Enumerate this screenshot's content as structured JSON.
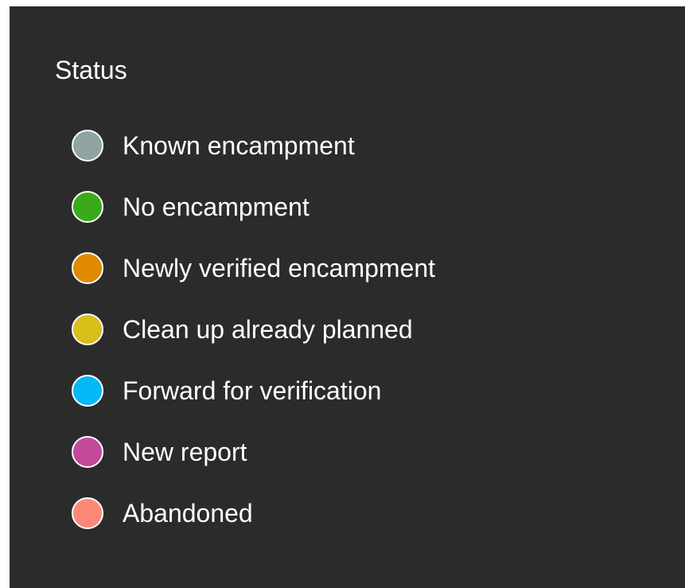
{
  "legend": {
    "title": "Status",
    "items": [
      {
        "label": "Known encampment",
        "color": "#8fa4a3"
      },
      {
        "label": "No encampment",
        "color": "#3aaa1a"
      },
      {
        "label": "Newly verified encampment",
        "color": "#e08a00"
      },
      {
        "label": "Clean up already planned",
        "color": "#d9bf1a"
      },
      {
        "label": "Forward for verification",
        "color": "#05b8f5"
      },
      {
        "label": "New report",
        "color": "#c2489a"
      },
      {
        "label": "Abandoned",
        "color": "#fd8878"
      }
    ]
  }
}
